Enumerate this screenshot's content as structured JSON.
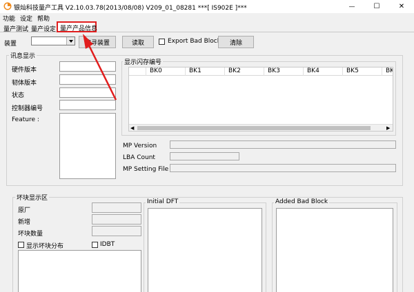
{
  "window": {
    "title": "银灿科技量产工具 V2.10.03.78(2013/08/08)      V209_01_08281           ***[ IS902E ]***",
    "controls": {
      "minimize": "—",
      "maximize": "☐",
      "close": "✕"
    }
  },
  "menu": [
    "功能",
    "设定",
    "帮助"
  ],
  "tabs": [
    {
      "label": "量产测试"
    },
    {
      "label": "量产设定"
    },
    {
      "label": "量产产品信息"
    }
  ],
  "toolbar": {
    "device_label": "装置",
    "search_button": "搜寻装置",
    "read_button": "读取",
    "export_bad_block": "Export Bad Block",
    "clear_button": "清除"
  },
  "info_group": {
    "title": "讯息显示",
    "fields": [
      "硬件版本",
      "韧体版本",
      "状态",
      "控制器编号",
      "Feature :"
    ]
  },
  "flash_group": {
    "title": "显示闪存编号",
    "columns": [
      "BK0",
      "BK1",
      "BK2",
      "BK3",
      "BK4",
      "BK5",
      "BK"
    ]
  },
  "mp_info": {
    "fields": [
      "MP Version",
      "LBA Count",
      "MP Setting File"
    ]
  },
  "bad_block_group": {
    "title": "坏块显示区",
    "fields": [
      "原厂",
      "新增",
      "坏块数量"
    ],
    "show_bad_block_dist": "显示坏块分布",
    "idbt": "IDBT"
  },
  "initial_dft": {
    "title": "Initial DFT"
  },
  "added_bad_block": {
    "title": "Added Bad Block"
  },
  "annotation": {
    "color": "#e11d1d"
  }
}
